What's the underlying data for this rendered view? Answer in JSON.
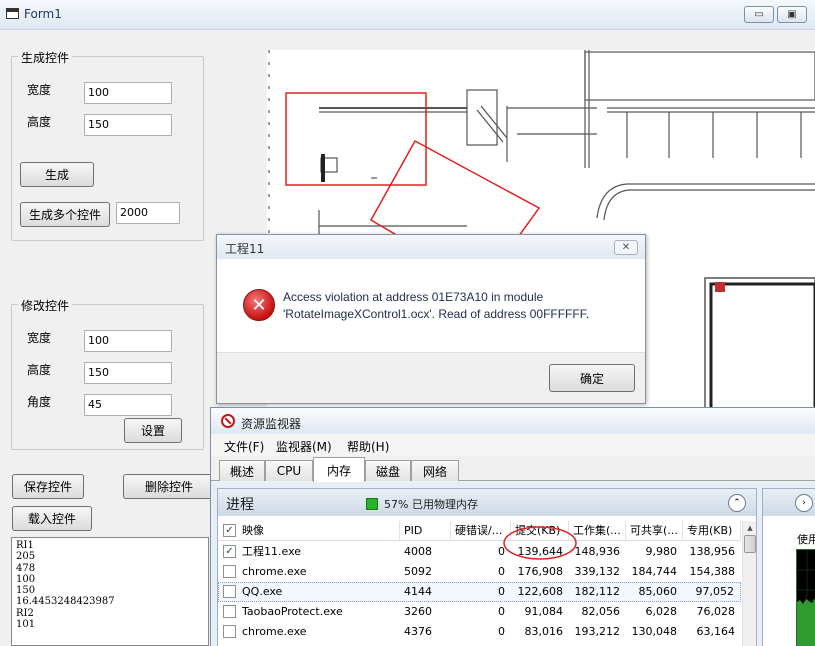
{
  "form": {
    "title": "Form1",
    "controls": {
      "min": "▭",
      "max": "▣"
    }
  },
  "generate_group": {
    "label": "生成控件",
    "width_label": "宽度",
    "width_value": "100",
    "height_label": "高度",
    "height_value": "150",
    "generate_button": "生成",
    "generate_multi_button": "生成多个控件",
    "count_value": "2000"
  },
  "modify_group": {
    "label": "修改控件",
    "width_label": "宽度",
    "width_value": "100",
    "height_label": "高度",
    "height_value": "150",
    "angle_label": "角度",
    "angle_value": "45",
    "set_button": "设置"
  },
  "actions": {
    "save_button": "保存控件",
    "delete_button": "删除控件",
    "load_button": "载入控件"
  },
  "memo": {
    "lines": [
      "RI1",
      "205",
      "478",
      "100",
      "150",
      "16.4453248423987",
      "RI2",
      "101"
    ]
  },
  "error_dialog": {
    "title": "工程11",
    "close": "✕",
    "icon": "✕",
    "message_line1": "Access violation at address 01E73A10 in module",
    "message_line2": "'RotateImageXControl1.ocx'. Read of address 00FFFFFF.",
    "ok_button": "确定"
  },
  "resource_monitor": {
    "title": "资源监视器",
    "menu": [
      "文件(F)",
      "监视器(M)",
      "帮助(H)"
    ],
    "tabs": [
      "概述",
      "CPU",
      "内存",
      "磁盘",
      "网络"
    ],
    "active_tab": "内存",
    "process_panel": {
      "title": "进程",
      "status": "57% 已用物理内存",
      "collapse": "⌃"
    },
    "columns": [
      "映像",
      "PID",
      "硬错误/...",
      "提交(KB)",
      "工作集(...",
      "可共享(...",
      "专用(KB)"
    ],
    "rows": [
      {
        "checked": true,
        "name": "工程11.exe",
        "pid": "4008",
        "hard_faults": "0",
        "commit": "139,644",
        "working_set": "148,936",
        "shareable": "9,980",
        "private": "138,956"
      },
      {
        "checked": false,
        "name": "chrome.exe",
        "pid": "5092",
        "hard_faults": "0",
        "commit": "176,908",
        "working_set": "339,132",
        "shareable": "184,744",
        "private": "154,388"
      },
      {
        "checked": false,
        "name": "QQ.exe",
        "pid": "4144",
        "hard_faults": "0",
        "commit": "122,608",
        "working_set": "182,112",
        "shareable": "85,060",
        "private": "97,052"
      },
      {
        "checked": false,
        "name": "TaobaoProtect.exe",
        "pid": "3260",
        "hard_faults": "0",
        "commit": "91,084",
        "working_set": "82,056",
        "shareable": "6,028",
        "private": "76,028"
      },
      {
        "checked": false,
        "name": "chrome.exe",
        "pid": "4376",
        "hard_faults": "0",
        "commit": "83,016",
        "working_set": "193,212",
        "shareable": "130,048",
        "private": "63,164"
      }
    ],
    "right_panel": {
      "label": "使用",
      "expand": "›"
    },
    "colors": {
      "annotation": "#e02020",
      "meter": "#28b428"
    }
  }
}
